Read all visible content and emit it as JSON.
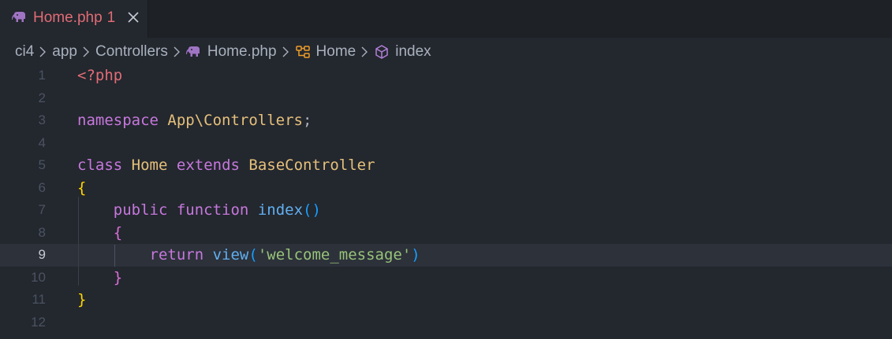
{
  "colors": {
    "tab_label": "#e06c75",
    "php_icon": "#a074c4",
    "tag": "#e06c75",
    "keyword": "#c678dd",
    "class_name": "#e5c07b",
    "function_name": "#61afef",
    "string": "#98c379",
    "brace_outer": "#ffd700",
    "brace_inner": "#da70d6",
    "paren": "#179fff",
    "default_text": "#abb2bf"
  },
  "tab": {
    "icon": "php-elephant-icon",
    "filename": "Home.php",
    "problem_count": "1",
    "close_icon": "close-icon"
  },
  "breadcrumb": {
    "items": [
      {
        "label": "ci4"
      },
      {
        "label": "app"
      },
      {
        "label": "Controllers"
      },
      {
        "label": "Home.php",
        "icon": "php-elephant-icon"
      },
      {
        "label": "Home",
        "icon": "class-icon"
      },
      {
        "label": "index",
        "icon": "method-cube-icon"
      }
    ]
  },
  "editor": {
    "active_line": 9,
    "lines": [
      {
        "number": "1",
        "tokens": [
          {
            "t": "<?php",
            "c": "tag"
          }
        ]
      },
      {
        "number": "2",
        "tokens": []
      },
      {
        "number": "3",
        "tokens": [
          {
            "t": "namespace",
            "c": "keyword"
          },
          {
            "t": " ",
            "c": "default_text"
          },
          {
            "t": "App\\Controllers",
            "c": "class_name"
          },
          {
            "t": ";",
            "c": "default_text"
          }
        ]
      },
      {
        "number": "4",
        "tokens": []
      },
      {
        "number": "5",
        "tokens": [
          {
            "t": "class",
            "c": "keyword"
          },
          {
            "t": " ",
            "c": "default_text"
          },
          {
            "t": "Home",
            "c": "class_name"
          },
          {
            "t": " ",
            "c": "default_text"
          },
          {
            "t": "extends",
            "c": "keyword"
          },
          {
            "t": " ",
            "c": "default_text"
          },
          {
            "t": "BaseController",
            "c": "class_name"
          }
        ]
      },
      {
        "number": "6",
        "tokens": [
          {
            "t": "{",
            "c": "brace_outer"
          }
        ]
      },
      {
        "number": "7",
        "tokens": [
          {
            "t": "    ",
            "c": "default_text"
          },
          {
            "t": "public",
            "c": "keyword"
          },
          {
            "t": " ",
            "c": "default_text"
          },
          {
            "t": "function",
            "c": "keyword"
          },
          {
            "t": " ",
            "c": "default_text"
          },
          {
            "t": "index",
            "c": "function_name"
          },
          {
            "t": "()",
            "c": "paren"
          }
        ]
      },
      {
        "number": "8",
        "tokens": [
          {
            "t": "    ",
            "c": "default_text"
          },
          {
            "t": "{",
            "c": "brace_inner"
          }
        ]
      },
      {
        "number": "9",
        "tokens": [
          {
            "t": "        ",
            "c": "default_text"
          },
          {
            "t": "return",
            "c": "keyword"
          },
          {
            "t": " ",
            "c": "default_text"
          },
          {
            "t": "view",
            "c": "function_name"
          },
          {
            "t": "(",
            "c": "paren"
          },
          {
            "t": "'welcome_message'",
            "c": "string"
          },
          {
            "t": ")",
            "c": "paren"
          }
        ]
      },
      {
        "number": "10",
        "tokens": [
          {
            "t": "    ",
            "c": "default_text"
          },
          {
            "t": "}",
            "c": "brace_inner"
          }
        ]
      },
      {
        "number": "11",
        "tokens": [
          {
            "t": "}",
            "c": "brace_outer"
          }
        ]
      },
      {
        "number": "12",
        "tokens": []
      }
    ]
  }
}
